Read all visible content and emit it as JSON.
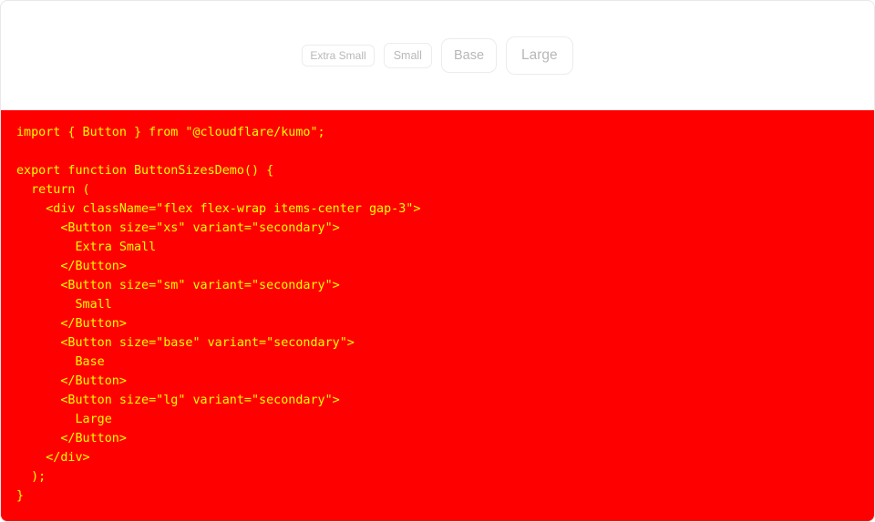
{
  "preview": {
    "buttons": [
      {
        "label": "Extra Small",
        "size": "xs"
      },
      {
        "label": "Small",
        "size": "sm"
      },
      {
        "label": "Base",
        "size": "base"
      },
      {
        "label": "Large",
        "size": "lg"
      }
    ]
  },
  "code": {
    "lines": [
      "import { Button } from \"@cloudflare/kumo\";",
      "",
      "export function ButtonSizesDemo() {",
      "  return (",
      "    <div className=\"flex flex-wrap items-center gap-3\">",
      "      <Button size=\"xs\" variant=\"secondary\">",
      "        Extra Small",
      "      </Button>",
      "      <Button size=\"sm\" variant=\"secondary\">",
      "        Small",
      "      </Button>",
      "      <Button size=\"base\" variant=\"secondary\">",
      "        Base",
      "      </Button>",
      "      <Button size=\"lg\" variant=\"secondary\">",
      "        Large",
      "      </Button>",
      "    </div>",
      "  );",
      "}"
    ]
  },
  "colors": {
    "code_background": "#ff0000",
    "code_text": "#ffff00",
    "button_text": "#b8b8b8",
    "button_border": "#ececec"
  }
}
